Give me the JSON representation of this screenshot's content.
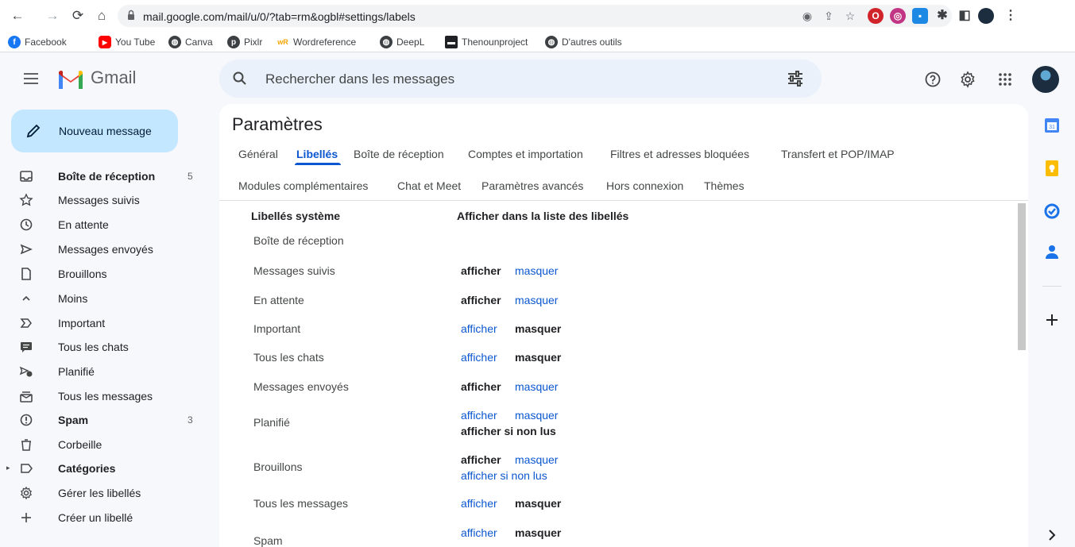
{
  "browser": {
    "url": "mail.google.com/mail/u/0/?tab=rm&ogbl#settings/labels",
    "bookmarks": [
      {
        "label": "Facebook",
        "icon": "facebook-icon",
        "color": "#1877f2"
      },
      {
        "label": "You Tube",
        "icon": "youtube-icon",
        "color": "#ff0000"
      },
      {
        "label": "Canva",
        "icon": "globe-icon",
        "color": "#3c4043"
      },
      {
        "label": "Pixlr",
        "icon": "pixlr-icon",
        "color": "#3c4043"
      },
      {
        "label": "Wordreference",
        "icon": "wordreference-icon",
        "color": "#f4a400"
      },
      {
        "label": "DeepL",
        "icon": "globe-icon",
        "color": "#3c4043"
      },
      {
        "label": "Thenounproject",
        "icon": "nounproject-icon",
        "color": "#202124"
      },
      {
        "label": "D'autres outils",
        "icon": "globe-icon",
        "color": "#3c4043"
      }
    ]
  },
  "header": {
    "app_name": "Gmail",
    "search_placeholder": "Rechercher dans les messages"
  },
  "sidebar": {
    "compose_label": "Nouveau message",
    "items": [
      {
        "label": "Boîte de réception",
        "count": "5",
        "bold": true,
        "icon": "inbox-icon"
      },
      {
        "label": "Messages suivis",
        "count": "",
        "bold": false,
        "icon": "star-icon"
      },
      {
        "label": "En attente",
        "count": "",
        "bold": false,
        "icon": "clock-icon"
      },
      {
        "label": "Messages envoyés",
        "count": "",
        "bold": false,
        "icon": "send-icon"
      },
      {
        "label": "Brouillons",
        "count": "",
        "bold": false,
        "icon": "draft-icon"
      },
      {
        "label": "Moins",
        "count": "",
        "bold": false,
        "icon": "chevron-up-icon"
      },
      {
        "label": "Important",
        "count": "",
        "bold": false,
        "icon": "important-icon"
      },
      {
        "label": "Tous les chats",
        "count": "",
        "bold": false,
        "icon": "chat-icon"
      },
      {
        "label": "Planifié",
        "count": "",
        "bold": false,
        "icon": "scheduled-icon"
      },
      {
        "label": "Tous les messages",
        "count": "",
        "bold": false,
        "icon": "all-mail-icon"
      },
      {
        "label": "Spam",
        "count": "3",
        "bold": true,
        "icon": "spam-icon"
      },
      {
        "label": "Corbeille",
        "count": "",
        "bold": false,
        "icon": "trash-icon"
      },
      {
        "label": "Catégories",
        "count": "",
        "bold": true,
        "icon": "label-icon"
      },
      {
        "label": "Gérer les libellés",
        "count": "",
        "bold": false,
        "icon": "gear-icon"
      },
      {
        "label": "Créer un libellé",
        "count": "",
        "bold": false,
        "icon": "plus-icon"
      }
    ]
  },
  "settings": {
    "title": "Paramètres",
    "tabs_row1": [
      "Général",
      "Libellés",
      "Boîte de réception",
      "Comptes et importation",
      "Filtres et adresses bloquées",
      "Transfert et POP/IMAP"
    ],
    "tabs_row2": [
      "Modules complémentaires",
      "Chat et Meet",
      "Paramètres avancés",
      "Hors connexion",
      "Thèmes"
    ],
    "active_tab": "Libellés",
    "col_system": "Libellés système",
    "col_show": "Afficher dans la liste des libellés",
    "rows": [
      {
        "name": "Boîte de réception",
        "actions": []
      },
      {
        "name": "Messages suivis",
        "actions": [
          [
            "afficher",
            "cur"
          ],
          [
            "masquer",
            "link"
          ]
        ]
      },
      {
        "name": "En attente",
        "actions": [
          [
            "afficher",
            "cur"
          ],
          [
            "masquer",
            "link"
          ]
        ]
      },
      {
        "name": "Important",
        "actions": [
          [
            "afficher",
            "link"
          ],
          [
            "masquer",
            "cur"
          ]
        ]
      },
      {
        "name": "Tous les chats",
        "actions": [
          [
            "afficher",
            "link"
          ],
          [
            "masquer",
            "cur"
          ]
        ]
      },
      {
        "name": "Messages envoyés",
        "actions": [
          [
            "afficher",
            "cur"
          ],
          [
            "masquer",
            "link"
          ]
        ]
      },
      {
        "name": "Planifié",
        "actions": [
          [
            "afficher",
            "link"
          ],
          [
            "masquer",
            "link"
          ]
        ],
        "extra": [
          "afficher si non lus",
          "cur"
        ]
      },
      {
        "name": "Brouillons",
        "actions": [
          [
            "afficher",
            "cur"
          ],
          [
            "masquer",
            "link"
          ]
        ],
        "extra": [
          "afficher si non lus",
          "link"
        ]
      },
      {
        "name": "Tous les messages",
        "actions": [
          [
            "afficher",
            "link"
          ],
          [
            "masquer",
            "cur"
          ]
        ]
      },
      {
        "name": "Spam",
        "actions": [
          [
            "afficher",
            "link"
          ],
          [
            "masquer",
            "cur"
          ]
        ]
      }
    ]
  },
  "colors": {
    "accent": "#0b57d0",
    "compose_bg": "#c2e7ff",
    "search_bg": "#eaf1fb",
    "page_bg": "#f6f8fc"
  }
}
